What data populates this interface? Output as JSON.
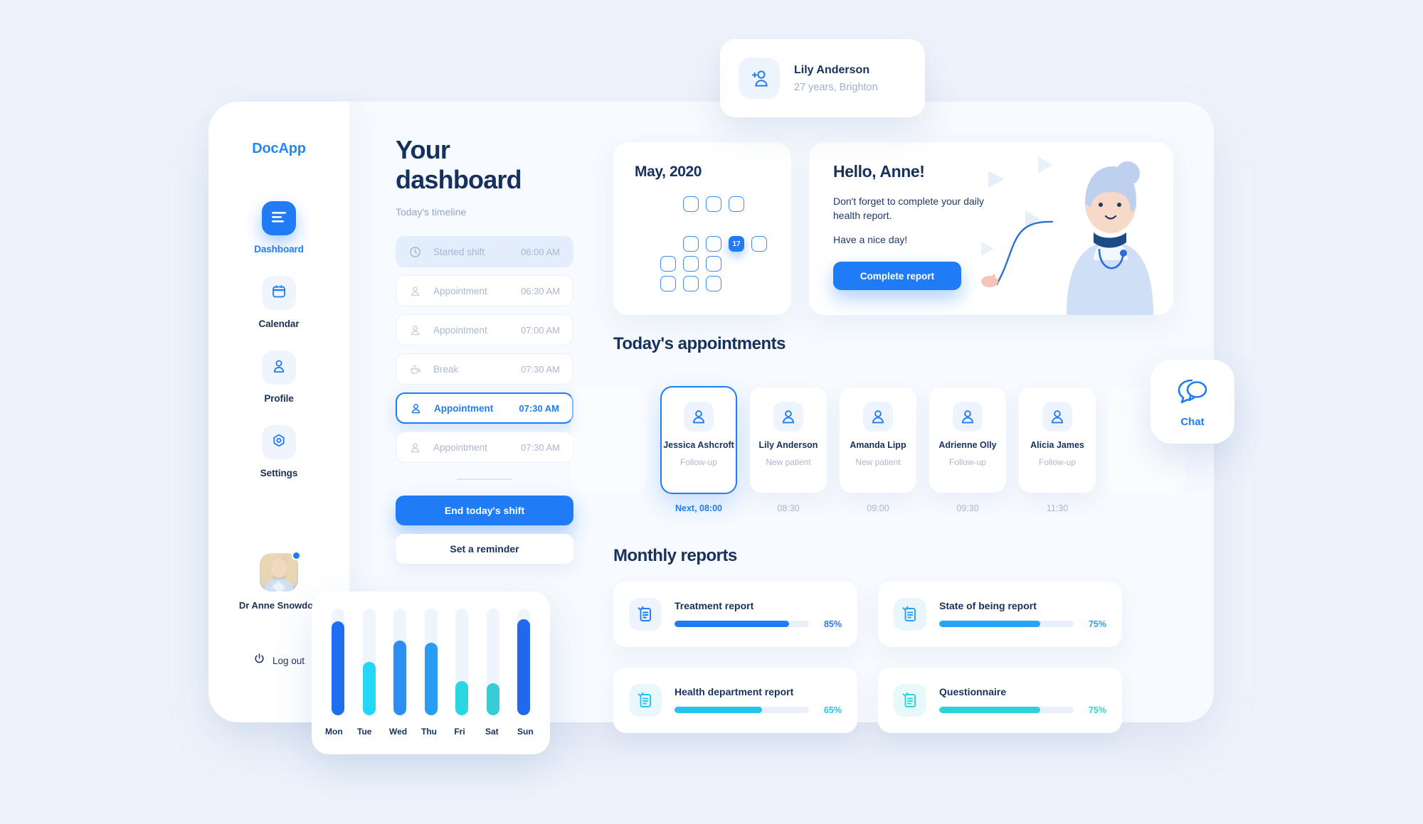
{
  "brand": {
    "name": "DocApp"
  },
  "sidebar": {
    "items": [
      {
        "label": "Dashboard",
        "icon": "dashboard-icon",
        "active": true
      },
      {
        "label": "Calendar",
        "icon": "calendar-icon",
        "active": false
      },
      {
        "label": "Profile",
        "icon": "user-icon",
        "active": false
      },
      {
        "label": "Settings",
        "icon": "gear-icon",
        "active": false
      }
    ],
    "user": {
      "name": "Dr Anne Snowdon",
      "status": "online"
    },
    "logout": {
      "label": "Log out",
      "icon": "power-icon"
    }
  },
  "panel": {
    "title": "Your dashboard",
    "subtitle": "Today's timeline",
    "timeline": [
      {
        "label": "Started shift",
        "time": "06:00 AM",
        "icon": "clock-icon",
        "state": "done"
      },
      {
        "label": "Appointment",
        "time": "06:30 AM",
        "icon": "user-icon",
        "state": "past"
      },
      {
        "label": "Appointment",
        "time": "07:00 AM",
        "icon": "user-icon",
        "state": "past"
      },
      {
        "label": "Break",
        "time": "07:30 AM",
        "icon": "coffee-icon",
        "state": "past"
      },
      {
        "label": "Appointment",
        "time": "07:30 AM",
        "icon": "user-icon",
        "state": "active"
      },
      {
        "label": "Appointment",
        "time": "07:30 AM",
        "icon": "user-icon",
        "state": "past"
      }
    ],
    "end_shift_label": "End today's shift",
    "reminder_label": "Set a reminder"
  },
  "calendar": {
    "title": "May, 2020",
    "today": "17",
    "rows": [
      [
        "blank",
        "off",
        "on",
        "on",
        "on",
        "off",
        "blank"
      ],
      [
        "off",
        "off",
        "off",
        "off",
        "off",
        "off",
        "off"
      ],
      [
        "off",
        "off",
        "on",
        "on",
        "today",
        "on",
        "off"
      ],
      [
        "off",
        "on",
        "on",
        "on",
        "off",
        "off",
        "off"
      ],
      [
        "off",
        "on",
        "on",
        "on",
        "blank",
        "blank",
        "blank"
      ]
    ]
  },
  "greeting": {
    "heading": "Hello, Anne!",
    "message": "Don't forget to complete your daily health report.",
    "closing": "Have a nice day!",
    "button_label": "Complete report"
  },
  "appointments": {
    "title": "Today's appointments",
    "items": [
      {
        "name": "Jessica Ashcroft",
        "type": "Follow-up",
        "time": "Next, 08:00",
        "selected": true
      },
      {
        "name": "Lily Anderson",
        "type": "New patient",
        "time": "08:30",
        "selected": false
      },
      {
        "name": "Amanda Lipp",
        "type": "New patient",
        "time": "09:00",
        "selected": false
      },
      {
        "name": "Adrienne Olly",
        "type": "Follow-up",
        "time": "09:30",
        "selected": false
      },
      {
        "name": "Alicia James",
        "type": "Follow-up",
        "time": "11:30",
        "selected": false
      }
    ]
  },
  "reports": {
    "title": "Monthly reports",
    "items": [
      {
        "name": "Treatment report",
        "percent": "85%",
        "value": 85,
        "color": "#1f7cf5",
        "tint": "#eef4fd"
      },
      {
        "name": "State of being report",
        "percent": "75%",
        "value": 75,
        "color": "#29a3f5",
        "tint": "#eaf6fe"
      },
      {
        "name": "Health department report",
        "percent": "65%",
        "value": 65,
        "color": "#23c4ee",
        "tint": "#e8f8fd"
      },
      {
        "name": "Questionnaire",
        "percent": "75%",
        "value": 75,
        "color": "#2fd2d9",
        "tint": "#e7fafb"
      }
    ]
  },
  "patient_chip": {
    "name": "Lily Anderson",
    "meta": "27 years, Brighton",
    "icon": "add-user-icon"
  },
  "chat": {
    "label": "Chat",
    "icon": "chat-bubbles-icon"
  },
  "chart_data": {
    "type": "bar",
    "title": "",
    "categories": [
      "Mon",
      "Tue",
      "Wed",
      "Thu",
      "Fri",
      "Sat",
      "Sun"
    ],
    "values": [
      88,
      50,
      70,
      68,
      32,
      30,
      90
    ],
    "colors": [
      "#1f6ef0",
      "#23d7f5",
      "#2b8ef2",
      "#2b9cf4",
      "#2ad6e0",
      "#37ccd3",
      "#2268ee"
    ],
    "xlabel": "",
    "ylabel": "",
    "ylim": [
      0,
      100
    ],
    "grid": false,
    "legend": false
  }
}
